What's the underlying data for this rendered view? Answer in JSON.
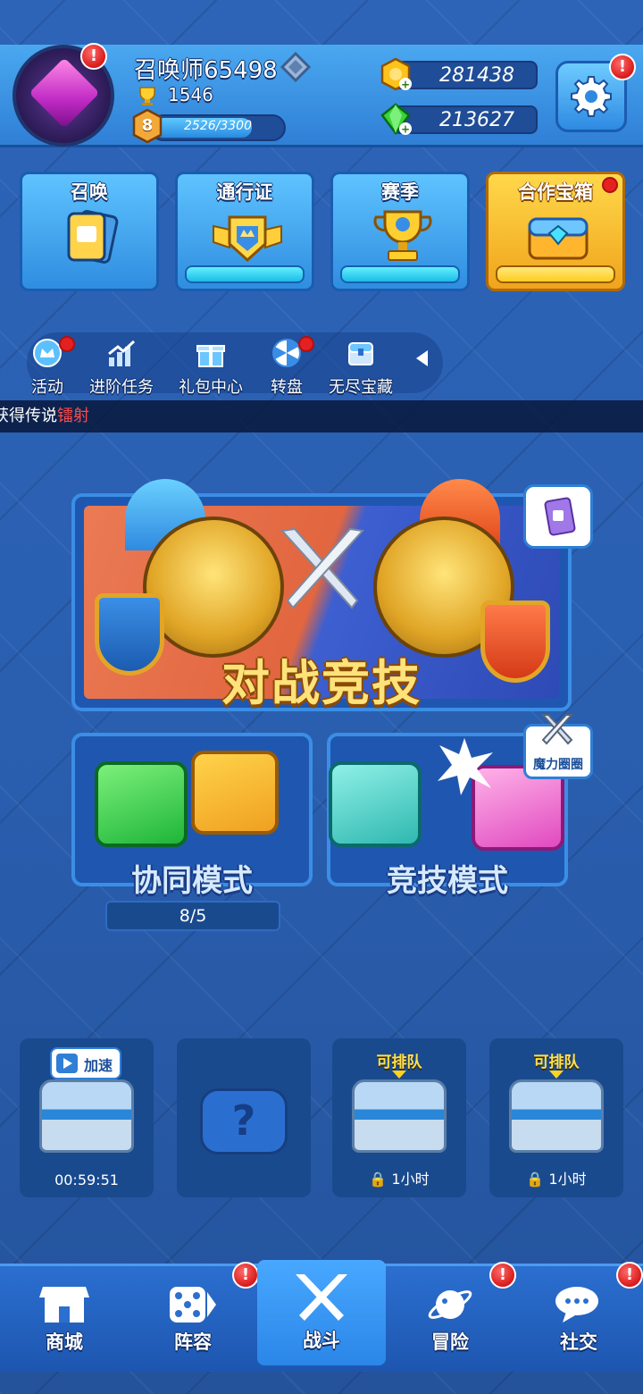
{
  "player": {
    "name": "召唤师65498",
    "trophies": "1546",
    "level": "8",
    "xp_text": "2526/3300",
    "xp_progress": 0.7655
  },
  "currency": {
    "gold": "281438",
    "gems": "213627"
  },
  "mode_cards": [
    {
      "label": "召唤"
    },
    {
      "label": "通行证"
    },
    {
      "label": "赛季"
    },
    {
      "label": "合作宝箱"
    }
  ],
  "quick_menu": [
    {
      "label": "活动"
    },
    {
      "label": "进阶任务"
    },
    {
      "label": "礼包中心"
    },
    {
      "label": "转盘"
    },
    {
      "label": "无尽宝藏"
    }
  ],
  "ticker": {
    "prefix": "获得传说",
    "highlight": "镭射"
  },
  "arena": {
    "title": "对战竞技"
  },
  "co_op": {
    "title": "协同模式",
    "progress_text": "8/5"
  },
  "pvp": {
    "title": "竞技模式",
    "badge": "魔力圈圈"
  },
  "chests": [
    {
      "tag": "加速",
      "timer": "00:59:51"
    },
    {
      "symbol": "?"
    },
    {
      "queue": "可排队",
      "time": "1小时"
    },
    {
      "queue": "可排队",
      "time": "1小时"
    }
  ],
  "nav": [
    {
      "label": "商城"
    },
    {
      "label": "阵容"
    },
    {
      "label": "战斗"
    },
    {
      "label": "冒险"
    },
    {
      "label": "社交"
    }
  ],
  "alert_symbol": "!"
}
